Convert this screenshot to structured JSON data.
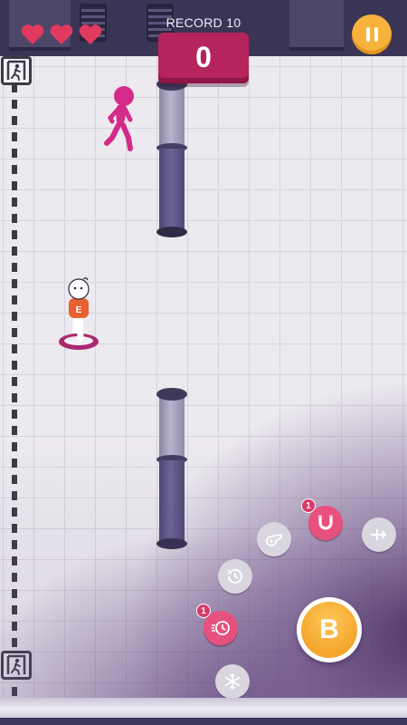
{
  "hud": {
    "lives": 3,
    "record_label": "RECORD 10",
    "score": "0",
    "pause_icon": "pause-icon"
  },
  "colors": {
    "heart": "#e23a5f",
    "score_panel": "#b5245d",
    "pause_button": "#f7b23c",
    "enemy": "#d42a8a",
    "powerup_active": "#e8507d",
    "action_button": "#f4a52a"
  },
  "powerups": [
    {
      "name": "whistle",
      "icon": "whistle-icon",
      "active": false,
      "count": ""
    },
    {
      "name": "magnet",
      "icon": "magnet-icon",
      "active": true,
      "count": "1"
    },
    {
      "name": "dash",
      "icon": "dash-icon",
      "active": false,
      "count": ""
    },
    {
      "name": "time-rewind",
      "icon": "clock-rewind-icon",
      "active": false,
      "count": ""
    },
    {
      "name": "speed-boost",
      "icon": "speed-clock-icon",
      "active": true,
      "count": "1"
    },
    {
      "name": "freeze",
      "icon": "snowflake-icon",
      "active": false,
      "count": ""
    }
  ],
  "action_button": {
    "label": "B"
  },
  "player": {
    "shirt_letter": "E"
  }
}
